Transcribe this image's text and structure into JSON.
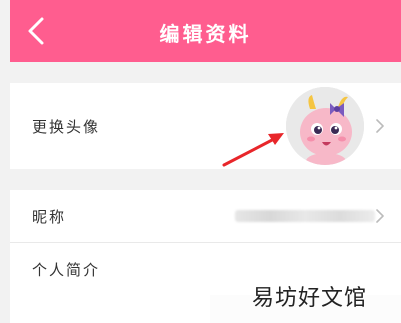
{
  "header": {
    "title": "编辑资料",
    "back_icon": "chevron-left-icon"
  },
  "profile": {
    "avatar_row_label": "更换头像",
    "nickname_label": "昵称",
    "intro_label": "个人简介"
  },
  "colors": {
    "header_bg": "#ff5d8f",
    "arrow": "#e8262a"
  },
  "watermark": "易坊好文馆"
}
